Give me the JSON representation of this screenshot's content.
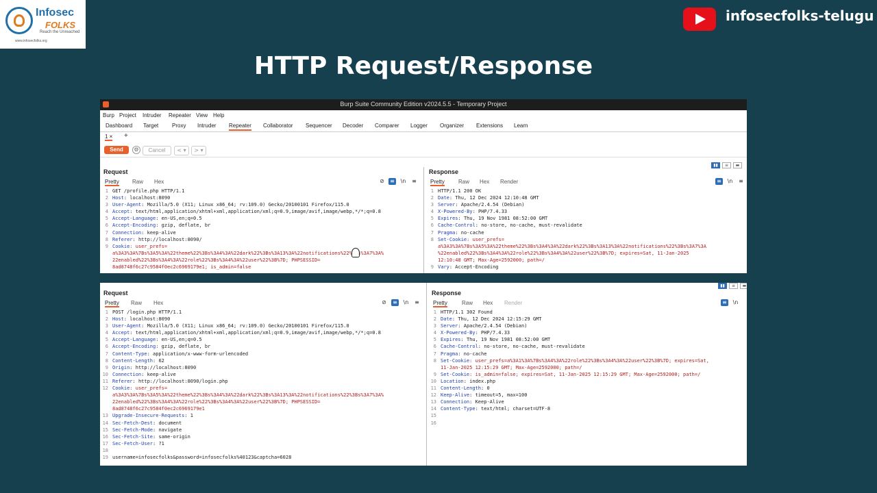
{
  "branding": {
    "logo_top": "Infosec",
    "logo_bottom": "FOLKS",
    "logo_tagline": "Reach the Unreached",
    "logo_url": "www.infosecfolks.org",
    "channel": "infosecfolks-telugu"
  },
  "title": "HTTP Request/Response",
  "app": {
    "window_title": "Burp Suite Community Edition v2024.5.5 - Temporary Project",
    "menu": [
      "Burp",
      "Project",
      "Intruder",
      "Repeater",
      "View",
      "Help"
    ],
    "tabs": [
      "Dashboard",
      "Target",
      "Proxy",
      "Intruder",
      "Repeater",
      "Collaborator",
      "Sequencer",
      "Decoder",
      "Comparer",
      "Logger",
      "Organizer",
      "Extensions",
      "Learn"
    ],
    "active_tab": "Repeater",
    "subtab": "1 ×",
    "plus": "+",
    "send_label": "Send",
    "cancel_label": "Cancel",
    "prev": "< ▾",
    "next": "> ▾",
    "gear": "⚙"
  },
  "panes": {
    "request_title": "Request",
    "response_title": "Response",
    "req_tabs": [
      "Pretty",
      "Raw",
      "Hex"
    ],
    "resp_tabs": [
      "Pretty",
      "Raw",
      "Hex",
      "Render"
    ],
    "icon_hide": "⊘",
    "icon_wrap": "≡",
    "icon_ln": "\\n",
    "icon_menu": "≡"
  },
  "top_request": [
    {
      "n": "1",
      "a": "GET /profile.php HTTP/1.1",
      "b": ""
    },
    {
      "n": "2",
      "a": "Host",
      "b": ": localhost:8090"
    },
    {
      "n": "3",
      "a": "User-Agent",
      "b": ": Mozilla/5.0 (X11; Linux x86_64; rv:109.0) Gecko/20100101 Firefox/115.0"
    },
    {
      "n": "4",
      "a": "Accept",
      "b": ": text/html,application/xhtml+xml,application/xml;q=0.9,image/avif,image/webp,*/*;q=0.8"
    },
    {
      "n": "5",
      "a": "Accept-Language",
      "b": ": en-US,en;q=0.5"
    },
    {
      "n": "6",
      "a": "Accept-Encoding",
      "b": ": gzip, deflate, br"
    },
    {
      "n": "7",
      "a": "Connection",
      "b": ": keep-alive"
    },
    {
      "n": "8",
      "a": "Referer",
      "b": ": http://localhost:8090/"
    },
    {
      "n": "9",
      "a": "Cookie",
      "b": ": user_prefs="
    },
    {
      "n": "",
      "a": "",
      "b": "a%3A3%3A%7Bs%3A5%3A%22theme%22%3Bs%3A4%3A%22dark%22%3Bs%3A13%3A%22notifications%22%3Bs%3A7%3A%"
    },
    {
      "n": "",
      "a": "",
      "b": "22enabled%22%3Bs%3A4%3A%22role%22%3Bs%3A4%3A%22user%22%3B%7D; PHPSESSID="
    },
    {
      "n": "",
      "a": "",
      "b": "8ad8748f6c27c9584f0ec2c6969179e1; is_admin=false"
    }
  ],
  "top_response": [
    {
      "n": "1",
      "a": "HTTP/1.1 200 OK",
      "b": ""
    },
    {
      "n": "2",
      "a": "Date",
      "b": ": Thu, 12 Dec 2024 12:10:48 GMT"
    },
    {
      "n": "3",
      "a": "Server",
      "b": ": Apache/2.4.54 (Debian)"
    },
    {
      "n": "4",
      "a": "X-Powered-By",
      "b": ": PHP/7.4.33"
    },
    {
      "n": "5",
      "a": "Expires",
      "b": ": Thu, 19 Nov 1981 08:52:00 GMT"
    },
    {
      "n": "6",
      "a": "Cache-Control",
      "b": ": no-store, no-cache, must-revalidate"
    },
    {
      "n": "7",
      "a": "Pragma",
      "b": ": no-cache"
    },
    {
      "n": "8",
      "a": "Set-Cookie",
      "b": ": user_prefs="
    },
    {
      "n": "",
      "a": "",
      "b": "a%3A3%3A%7Bs%3A5%3A%22theme%22%3Bs%3A4%3A%22dark%22%3Bs%3A13%3A%22notifications%22%3Bs%3A7%3A"
    },
    {
      "n": "",
      "a": "",
      "b": "%22enabled%22%3Bs%3A4%3A%22role%22%3Bs%3A4%3A%22user%22%3B%7D; expires=Sat, 11-Jan-2025"
    },
    {
      "n": "",
      "a": "",
      "b": "12:10:48 GMT; Max-Age=2592000; path=/"
    },
    {
      "n": "9",
      "a": "Vary",
      "b": ": Accept-Encoding"
    }
  ],
  "bottom_request": [
    {
      "n": "1",
      "a": "POST /login.php HTTP/1.1",
      "b": ""
    },
    {
      "n": "2",
      "a": "Host",
      "b": ": localhost:8090"
    },
    {
      "n": "3",
      "a": "User-Agent",
      "b": ": Mozilla/5.0 (X11; Linux x86_64; rv:109.0) Gecko/20100101 Firefox/115.0"
    },
    {
      "n": "4",
      "a": "Accept",
      "b": ": text/html,application/xhtml+xml,application/xml;q=0.9,image/avif,image/webp,*/*;q=0.8"
    },
    {
      "n": "5",
      "a": "Accept-Language",
      "b": ": en-US,en;q=0.5"
    },
    {
      "n": "6",
      "a": "Accept-Encoding",
      "b": ": gzip, deflate, br"
    },
    {
      "n": "7",
      "a": "Content-Type",
      "b": ": application/x-www-form-urlencoded"
    },
    {
      "n": "8",
      "a": "Content-Length",
      "b": ": 62"
    },
    {
      "n": "9",
      "a": "Origin",
      "b": ": http://localhost:8090"
    },
    {
      "n": "10",
      "a": "Connection",
      "b": ": keep-alive"
    },
    {
      "n": "11",
      "a": "Referer",
      "b": ": http://localhost:8090/login.php"
    },
    {
      "n": "12",
      "a": "Cookie",
      "b": ": user_prefs="
    },
    {
      "n": "",
      "a": "",
      "b": "a%3A3%3A%7Bs%3A5%3A%22theme%22%3Bs%3A4%3A%22dark%22%3Bs%3A13%3A%22notifications%22%3Bs%3A7%3A%"
    },
    {
      "n": "",
      "a": "",
      "b": "22enabled%22%3Bs%3A4%3A%22role%22%3Bs%3A4%3A%22user%22%3B%7D; PHPSESSID="
    },
    {
      "n": "",
      "a": "",
      "b": "8ad8748f6c27c9584f0ec2c6969179e1"
    },
    {
      "n": "13",
      "a": "Upgrade-Insecure-Requests",
      "b": ": 1"
    },
    {
      "n": "14",
      "a": "Sec-Fetch-Dest",
      "b": ": document"
    },
    {
      "n": "15",
      "a": "Sec-Fetch-Mode",
      "b": ": navigate"
    },
    {
      "n": "16",
      "a": "Sec-Fetch-Site",
      "b": ": same-origin"
    },
    {
      "n": "17",
      "a": "Sec-Fetch-User",
      "b": ": ?1"
    },
    {
      "n": "18",
      "a": "",
      "b": ""
    },
    {
      "n": "19",
      "a": "username=infosecfolks&password=infosecfolks%40123&captcha=6028",
      "b": ""
    }
  ],
  "bottom_response": [
    {
      "n": "1",
      "a": "HTTP/1.1 302 Found",
      "b": ""
    },
    {
      "n": "2",
      "a": "Date",
      "b": ": Thu, 12 Dec 2024 12:15:29 GMT"
    },
    {
      "n": "3",
      "a": "Server",
      "b": ": Apache/2.4.54 (Debian)"
    },
    {
      "n": "4",
      "a": "X-Powered-By",
      "b": ": PHP/7.4.33"
    },
    {
      "n": "5",
      "a": "Expires",
      "b": ": Thu, 19 Nov 1981 08:52:00 GMT"
    },
    {
      "n": "6",
      "a": "Cache-Control",
      "b": ": no-store, no-cache, must-revalidate"
    },
    {
      "n": "7",
      "a": "Pragma",
      "b": ": no-cache"
    },
    {
      "n": "8",
      "a": "Set-Cookie",
      "b": ": user_prefs=a%3A1%3A%7Bs%3A4%3A%22role%22%3Bs%3A4%3A%22user%22%3B%7D; expires=Sat,"
    },
    {
      "n": "",
      "a": "",
      "b": "11-Jan-2025 12:15:29 GMT; Max-Age=2592000; path=/"
    },
    {
      "n": "9",
      "a": "Set-Cookie",
      "b": ": is_admin=false; expires=Sat, 11-Jan-2025 12:15:29 GMT; Max-Age=2592000; path=/"
    },
    {
      "n": "10",
      "a": "Location",
      "b": ": index.php"
    },
    {
      "n": "11",
      "a": "Content-Length",
      "b": ": 0"
    },
    {
      "n": "12",
      "a": "Keep-Alive",
      "b": ": timeout=5, max=100"
    },
    {
      "n": "13",
      "a": "Connection",
      "b": ": Keep-Alive"
    },
    {
      "n": "14",
      "a": "Content-Type",
      "b": ": text/html; charset=UTF-8"
    },
    {
      "n": "15",
      "a": "",
      "b": ""
    },
    {
      "n": "16",
      "a": "",
      "b": ""
    }
  ]
}
